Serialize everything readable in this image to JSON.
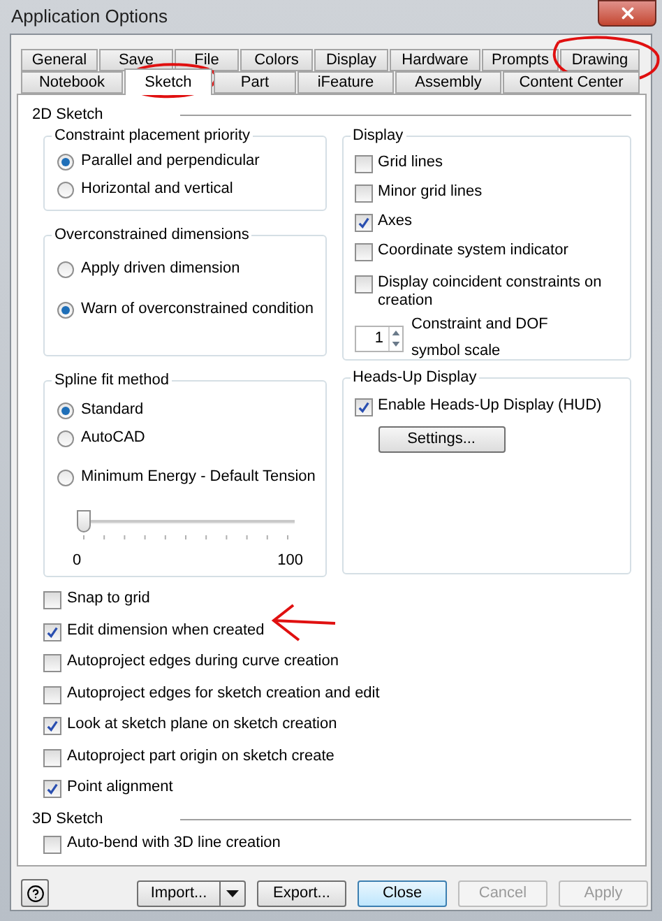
{
  "window": {
    "title": "Application Options"
  },
  "tab_rows": [
    {
      "tabs": [
        {
          "label": "General",
          "selected": false
        },
        {
          "label": "Save",
          "selected": false
        },
        {
          "label": "File",
          "selected": false
        },
        {
          "label": "Colors",
          "selected": false
        },
        {
          "label": "Display",
          "selected": false
        },
        {
          "label": "Hardware",
          "selected": false
        },
        {
          "label": "Prompts",
          "selected": false
        },
        {
          "label": "Drawing",
          "selected": false
        }
      ]
    },
    {
      "tabs": [
        {
          "label": "Notebook",
          "selected": false
        },
        {
          "label": "Sketch",
          "selected": true
        },
        {
          "label": "Part",
          "selected": false
        },
        {
          "label": "iFeature",
          "selected": false
        },
        {
          "label": "Assembly",
          "selected": false
        },
        {
          "label": "Content Center",
          "selected": false
        }
      ]
    }
  ],
  "sketch_2d": {
    "title": "2D Sketch",
    "constraint_priority": {
      "title": "Constraint placement priority",
      "options": [
        {
          "label": "Parallel and perpendicular",
          "selected": true
        },
        {
          "label": "Horizontal and vertical",
          "selected": false
        }
      ]
    },
    "overconstrained": {
      "title": "Overconstrained dimensions",
      "options": [
        {
          "label": "Apply driven dimension",
          "selected": false
        },
        {
          "label": "Warn of overconstrained condition",
          "selected": true
        }
      ]
    },
    "spline_fit": {
      "title": "Spline fit method",
      "options": [
        {
          "label": "Standard",
          "selected": true
        },
        {
          "label": "AutoCAD",
          "selected": false
        },
        {
          "label": "Minimum Energy - Default Tension",
          "selected": false
        }
      ],
      "slider": {
        "level": 0,
        "min_label": "0",
        "max_label": "100"
      }
    },
    "display": {
      "title": "Display",
      "options": [
        {
          "label": "Grid lines",
          "checked": false
        },
        {
          "label": "Minor grid lines",
          "checked": false
        },
        {
          "label": "Axes",
          "checked": true
        },
        {
          "label": "Coordinate system indicator",
          "checked": false
        },
        {
          "label": "Display coincident constraints on creation",
          "checked": false
        }
      ],
      "spinner": {
        "value": "1",
        "label": "Constraint and DOF symbol scale"
      }
    },
    "hud": {
      "title": "Heads-Up Display",
      "options": [
        {
          "label": "Enable Heads-Up Display (HUD)",
          "checked": true
        }
      ],
      "settings_button": "Settings..."
    },
    "options": [
      {
        "label": "Snap to grid",
        "checked": false
      },
      {
        "label": "Edit dimension when created",
        "checked": true
      },
      {
        "label": "Autoproject edges during curve creation",
        "checked": false
      },
      {
        "label": "Autoproject edges for sketch creation and edit",
        "checked": false
      },
      {
        "label": "Look at sketch plane on sketch creation",
        "checked": true
      },
      {
        "label": "Autoproject part origin on sketch create",
        "checked": false
      },
      {
        "label": "Point alignment",
        "checked": true
      }
    ]
  },
  "sketch_3d": {
    "title": "3D Sketch",
    "options": [
      {
        "label": "Auto-bend with 3D line creation",
        "checked": false
      }
    ]
  },
  "footer": {
    "buttons": [
      {
        "label": "Import...",
        "kind": "split",
        "disabled": false,
        "focused": false
      },
      {
        "label": "Export...",
        "kind": "plain",
        "disabled": false,
        "focused": false
      },
      {
        "label": "Close",
        "kind": "plain",
        "disabled": false,
        "focused": true
      },
      {
        "label": "Cancel",
        "kind": "plain",
        "disabled": true,
        "focused": false
      },
      {
        "label": "Apply",
        "kind": "plain",
        "disabled": true,
        "focused": false
      }
    ]
  }
}
